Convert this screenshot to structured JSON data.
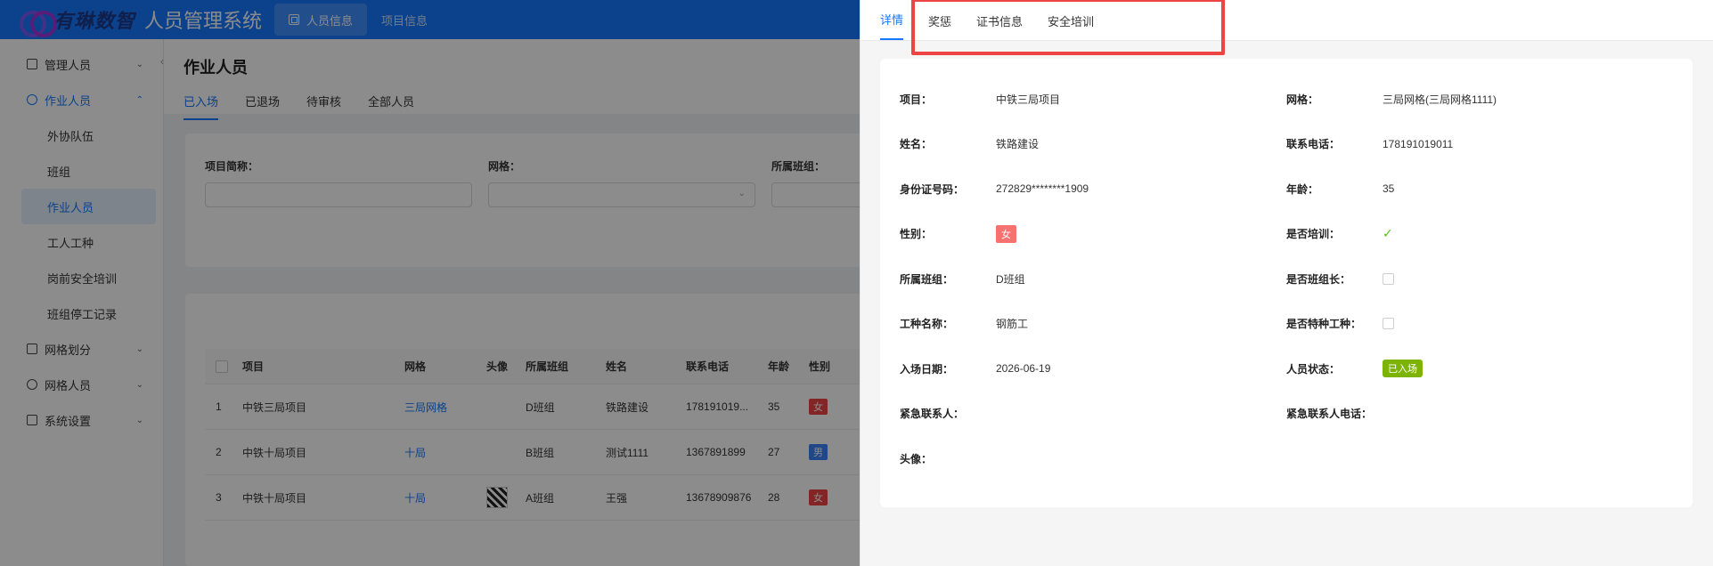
{
  "header": {
    "logo_text": "有琳数智",
    "app_title": "人员管理系统",
    "nav": [
      {
        "label": "人员信息",
        "active": true
      },
      {
        "label": "项目信息",
        "active": false
      }
    ]
  },
  "sidebar": {
    "groups": [
      {
        "label": "管理人员",
        "icon": "document-icon"
      },
      {
        "label": "作业人员",
        "icon": "user-icon"
      },
      {
        "label": "网格划分",
        "icon": "grid-icon"
      },
      {
        "label": "网格人员",
        "icon": "gear-icon"
      },
      {
        "label": "系统设置",
        "icon": "settings-icon"
      }
    ],
    "subitems": [
      "外协队伍",
      "班组",
      "作业人员",
      "工人工种",
      "岗前安全培训",
      "班组停工记录"
    ]
  },
  "main": {
    "title": "作业人员",
    "tabs": [
      "已入场",
      "已退场",
      "待审核",
      "全部人员"
    ],
    "filters": [
      {
        "label": "项目简称："
      },
      {
        "label": "网格："
      },
      {
        "label": "所属班组："
      }
    ],
    "table": {
      "headers": [
        "项目",
        "网格",
        "头像",
        "所属班组",
        "姓名",
        "联系电话",
        "年龄",
        "性别"
      ],
      "rows": [
        {
          "index": "1",
          "project": "中铁三局项目",
          "grid": "三局网格",
          "team": "D班组",
          "name": "铁路建设",
          "phone": "178191019...",
          "age": "35",
          "gender": "女"
        },
        {
          "index": "2",
          "project": "中铁十局项目",
          "grid": "十局",
          "team": "B班组",
          "name": "测试1111",
          "phone": "1367891899",
          "age": "27",
          "gender": "男"
        },
        {
          "index": "3",
          "project": "中铁十局项目",
          "grid": "十局",
          "team": "A班组",
          "name": "王强",
          "phone": "13678909876",
          "age": "28",
          "gender": "女"
        }
      ]
    }
  },
  "drawer": {
    "tabs": [
      "详情",
      "奖惩",
      "证书信息",
      "安全培训"
    ],
    "fields": {
      "project_label": "项目：",
      "project_value": "中铁三局项目",
      "grid_label": "网格：",
      "grid_value": "三局网格(三局网格1111)",
      "name_label": "姓名：",
      "name_value": "铁路建设",
      "phone_label": "联系电话：",
      "phone_value": "178191019011",
      "id_label": "身份证号码：",
      "id_value": "272829********1909",
      "age_label": "年龄：",
      "age_value": "35",
      "gender_label": "性别：",
      "gender_value": "女",
      "trained_label": "是否培训：",
      "team_label": "所属班组：",
      "team_value": "D班组",
      "leader_label": "是否班组长：",
      "trade_label": "工种名称：",
      "trade_value": "钢筋工",
      "special_label": "是否特种工种：",
      "entry_label": "入场日期：",
      "entry_value": "2026-06-19",
      "status_label": "人员状态：",
      "status_value": "已入场",
      "emergency_label": "紧急联系人：",
      "emergency_phone_label": "紧急联系人电话：",
      "avatar_label": "头像："
    }
  }
}
